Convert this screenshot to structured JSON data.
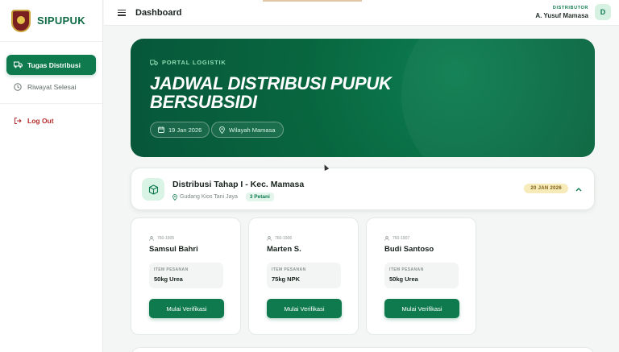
{
  "app": {
    "name": "SIPUPUK"
  },
  "sidebar": {
    "items": [
      {
        "label": "Tugas Distribusi",
        "icon": "truck-icon",
        "active": true
      },
      {
        "label": "Riwayat Selesai",
        "icon": "clock-icon",
        "active": false
      }
    ],
    "logout_label": "Log Out"
  },
  "header": {
    "title": "Dashboard",
    "user_role": "DISTRIBUTOR",
    "user_name": "A. Yusuf Mamasa",
    "avatar_initial": "D"
  },
  "hero": {
    "kicker": "PORTAL LOGISTIK",
    "title": "JADWAL DISTRIBUSI PUPUK BERSUBSIDI",
    "date_chip": "19 Jan 2026",
    "region_chip": "Wilayah Mamasa"
  },
  "stage": {
    "title": "Distribusi Tahap I - Kec. Mamasa",
    "location": "Gudang Kios Tani Jaya",
    "farmers": "3 Petani",
    "date": "20 JAN 2026"
  },
  "farmers": [
    {
      "id": "760-1905",
      "name": "Samsul Bahri",
      "item_label": "ITEM PESANAN",
      "item_value": "50kg Urea",
      "button": "Mulai Verifikasi"
    },
    {
      "id": "760-1906",
      "name": "Marten S.",
      "item_label": "ITEM PESANAN",
      "item_value": "75kg NPK",
      "button": "Mulai Verifikasi"
    },
    {
      "id": "760-1907",
      "name": "Budi Santoso",
      "item_label": "ITEM PESANAN",
      "item_value": "50kg Urea",
      "button": "Mulai Verifikasi"
    }
  ],
  "colors": {
    "primary": "#0f7a4e",
    "hero_bg": "#07573a",
    "accent_badge": "#f7ebba",
    "danger": "#b42d2d"
  }
}
